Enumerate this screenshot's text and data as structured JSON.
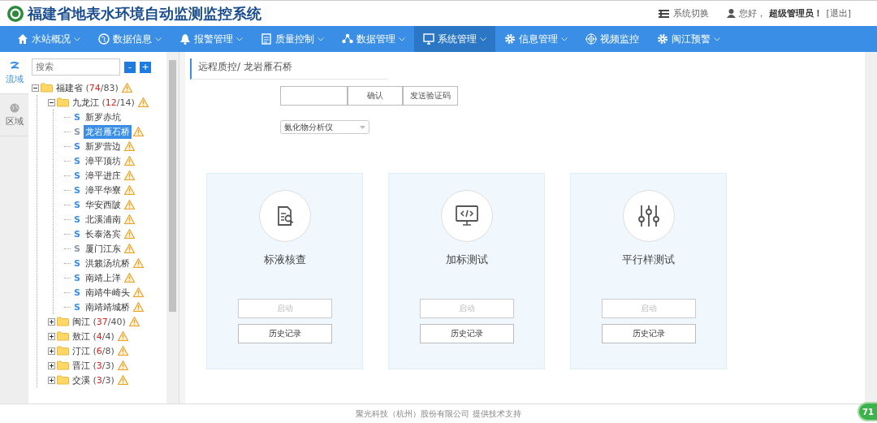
{
  "header": {
    "title": "福建省地表水环境自动监测监控系统",
    "switch_label": "系统切换",
    "greeting": "您好，",
    "user": "超级管理员！",
    "logout": "[退出]"
  },
  "nav": [
    {
      "label": "水站概况",
      "has_menu": true,
      "selected": false
    },
    {
      "label": "数据信息",
      "has_menu": true,
      "selected": false
    },
    {
      "label": "报警管理",
      "has_menu": true,
      "selected": false
    },
    {
      "label": "质量控制",
      "has_menu": true,
      "selected": false
    },
    {
      "label": "数据管理",
      "has_menu": true,
      "selected": false
    },
    {
      "label": "系统管理",
      "has_menu": true,
      "selected": true
    },
    {
      "label": "信息管理",
      "has_menu": true,
      "selected": false
    },
    {
      "label": "视频监控",
      "has_menu": false,
      "selected": false
    },
    {
      "label": "闽江预警",
      "has_menu": true,
      "selected": false
    }
  ],
  "side_tabs": [
    {
      "label": "流域",
      "selected": true
    },
    {
      "label": "区域",
      "selected": false
    }
  ],
  "tree": {
    "search_placeholder": "搜索",
    "collapse": "-",
    "expand": "+",
    "nodes": [
      {
        "name": "福建省",
        "open": "(",
        "alarm_count": "74",
        "total": "/83)",
        "warning": true,
        "expanded": true,
        "children": [
          {
            "name": "九龙江",
            "open": "(",
            "alarm_count": "12",
            "total": "/14)",
            "warning": true,
            "expanded": true,
            "children": [
              {
                "mark": "S",
                "name": "新罗赤坑",
                "online": true,
                "warning": false,
                "selected": false
              },
              {
                "mark": "S",
                "name": "龙岩雁石桥",
                "online": false,
                "warning": true,
                "selected": true
              },
              {
                "mark": "S",
                "name": "新罗营边",
                "online": true,
                "warning": true,
                "selected": false
              },
              {
                "mark": "S",
                "name": "漳平顶坊",
                "online": true,
                "warning": true,
                "selected": false
              },
              {
                "mark": "S",
                "name": "漳平进庄",
                "online": true,
                "warning": true,
                "selected": false
              },
              {
                "mark": "S",
                "name": "漳平华寮",
                "online": true,
                "warning": true,
                "selected": false
              },
              {
                "mark": "S",
                "name": "华安西陂",
                "online": true,
                "warning": true,
                "selected": false
              },
              {
                "mark": "S",
                "name": "北溪浦南",
                "online": true,
                "warning": true,
                "selected": false
              },
              {
                "mark": "S",
                "name": "长泰洛宾",
                "online": true,
                "warning": true,
                "selected": false
              },
              {
                "mark": "S",
                "name": "厦门江东",
                "online": false,
                "warning": true,
                "selected": false
              },
              {
                "mark": "S",
                "name": "洪籁汤坑桥",
                "online": true,
                "warning": true,
                "selected": false
              },
              {
                "mark": "S",
                "name": "南靖上洋",
                "online": true,
                "warning": true,
                "selected": false
              },
              {
                "mark": "S",
                "name": "南靖牛崎头",
                "online": true,
                "warning": true,
                "selected": false
              },
              {
                "mark": "S",
                "name": "南靖靖城桥",
                "online": true,
                "warning": true,
                "selected": false
              }
            ]
          },
          {
            "name": "闽江",
            "open": "(",
            "alarm_count": "37",
            "total": "/40)",
            "warning": true,
            "expanded": false
          },
          {
            "name": "敖江",
            "open": "(",
            "alarm_count": "4",
            "total": "/4)",
            "warning": true,
            "expanded": false
          },
          {
            "name": "汀江",
            "open": "(",
            "alarm_count": "6",
            "total": "/8)",
            "warning": true,
            "expanded": false
          },
          {
            "name": "晋江",
            "open": "(",
            "alarm_count": "3",
            "total": "/3)",
            "warning": true,
            "expanded": false
          },
          {
            "name": "交溪",
            "open": "(",
            "alarm_count": "3",
            "total": "/3)",
            "warning": true,
            "expanded": false
          }
        ]
      }
    ]
  },
  "breadcrumb": "远程质控/ 龙岩雁石桥",
  "verify": {
    "confirm": "确认",
    "send_code": "发送验证码"
  },
  "instrument_select": {
    "value": "氨化物分析仪"
  },
  "cards": [
    {
      "title": "标液核查",
      "start": "启动",
      "start_disabled": true,
      "history": "历史记录"
    },
    {
      "title": "加标测试",
      "start": "启动",
      "start_disabled": true,
      "history": "历史记录"
    },
    {
      "title": "平行样测试",
      "start": "启动",
      "start_disabled": true,
      "history": "历史记录"
    }
  ],
  "footer": "聚光科技（杭州）股份有限公司 提供技术支持",
  "badge": "71"
}
